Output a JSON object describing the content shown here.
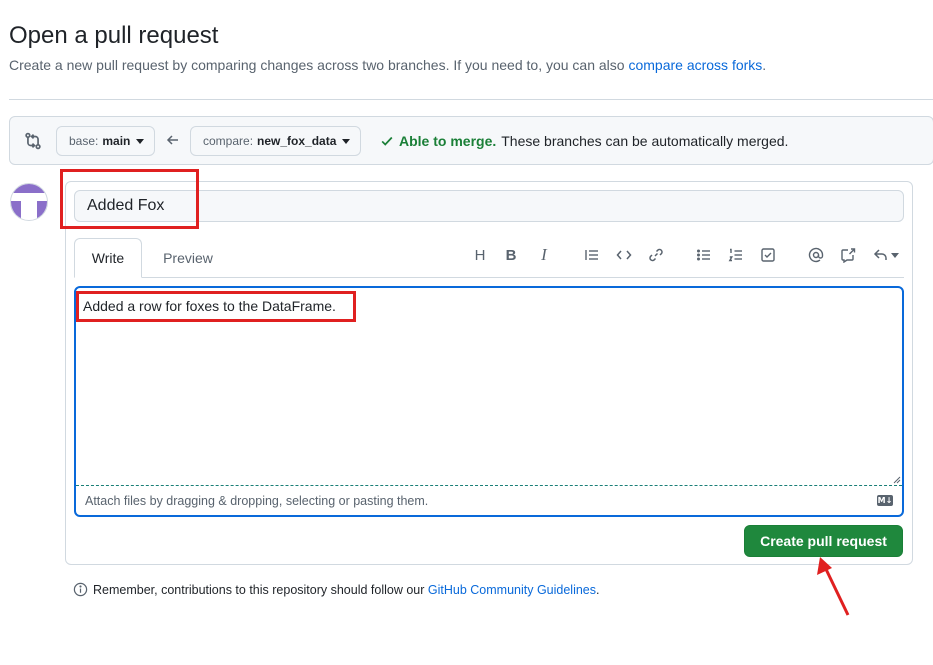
{
  "header": {
    "title": "Open a pull request",
    "subtitle_prefix": "Create a new pull request by comparing changes across two branches. If you need to, you can also ",
    "subtitle_link": "compare across forks",
    "subtitle_suffix": "."
  },
  "range": {
    "base_prefix": "base:",
    "base_branch": "main",
    "compare_prefix": "compare:",
    "compare_branch": "new_fox_data",
    "merge_ok": "Able to merge.",
    "merge_detail": "These branches can be automatically merged."
  },
  "composer": {
    "title_value": "Added Fox",
    "tabs": {
      "write": "Write",
      "preview": "Preview"
    },
    "body_text": "Added a row for foxes to the DataFrame.",
    "attach_hint": "Attach files by dragging & dropping, selecting or pasting them.",
    "markdown_badge": "M↓",
    "submit_label": "Create pull request"
  },
  "toolbar_icons": [
    "heading-icon",
    "bold-icon",
    "italic-icon",
    "quote-icon",
    "code-icon",
    "link-icon",
    "unordered-list-icon",
    "ordered-list-icon",
    "task-list-icon",
    "mention-icon",
    "cross-reference-icon",
    "reply-icon"
  ],
  "footer": {
    "prefix": "Remember, contributions to this repository should follow our ",
    "link": "GitHub Community Guidelines",
    "suffix": "."
  },
  "colors": {
    "accent": "#0969da",
    "success": "#1a7f37",
    "button_green": "#1f883d",
    "annotation_red": "#e02020",
    "avatar_purple": "#8a6fc9"
  }
}
